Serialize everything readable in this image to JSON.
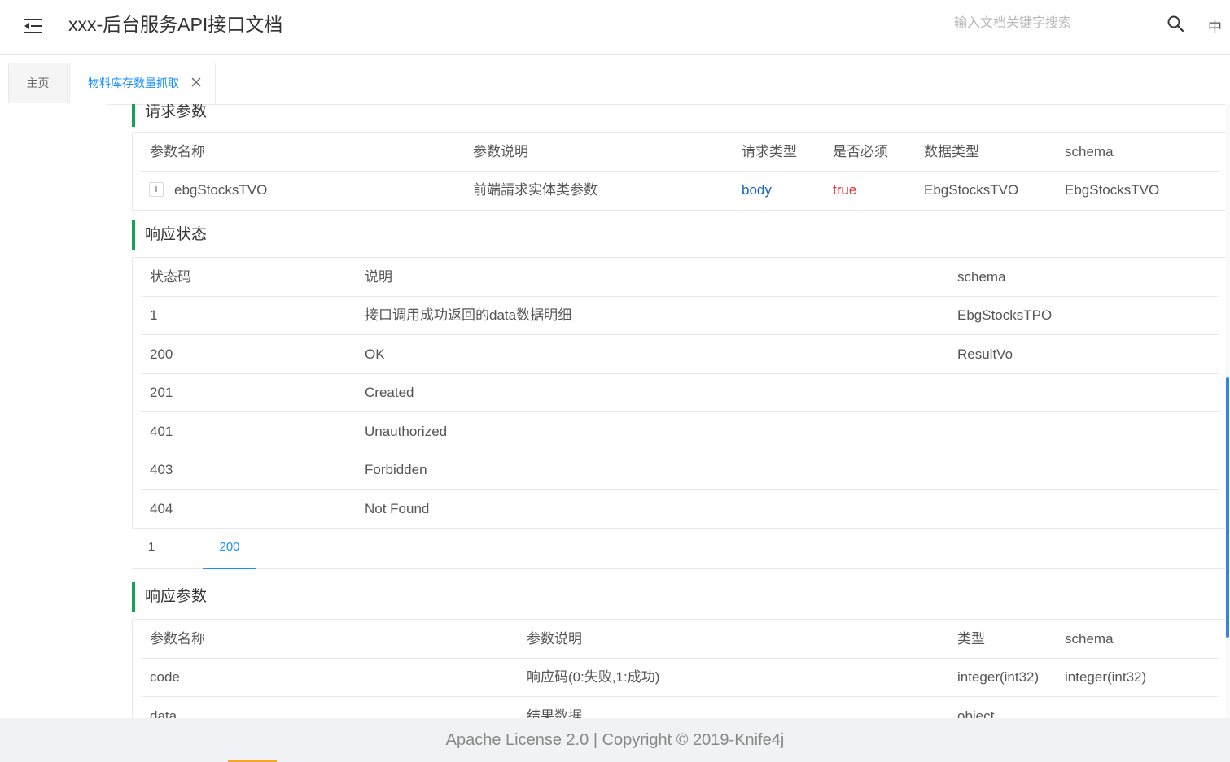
{
  "header": {
    "title": "xxx-后台服务API接口文档",
    "search_placeholder": "输入文档关键字搜索",
    "lang": "中"
  },
  "tabs": [
    {
      "label": "主页"
    },
    {
      "label": "物料库存数量抓取"
    }
  ],
  "request_params": {
    "title": "请求参数",
    "headers": [
      "参数名称",
      "参数说明",
      "请求类型",
      "是否必须",
      "数据类型",
      "schema"
    ],
    "rows": [
      {
        "expand": "+",
        "name": "ebgStocksTVO",
        "desc": "前端請求实体类参数",
        "in": "body",
        "required": "true",
        "type": "EbgStocksTVO",
        "schema": "EbgStocksTVO"
      }
    ]
  },
  "response_status": {
    "title": "响应状态",
    "headers": [
      "状态码",
      "说明",
      "schema"
    ],
    "rows": [
      {
        "code": "1",
        "desc": "接口调用成功返回的data数据明细",
        "schema": "EbgStocksTPO"
      },
      {
        "code": "200",
        "desc": "OK",
        "schema": "ResultVo"
      },
      {
        "code": "201",
        "desc": "Created",
        "schema": ""
      },
      {
        "code": "401",
        "desc": "Unauthorized",
        "schema": ""
      },
      {
        "code": "403",
        "desc": "Forbidden",
        "schema": ""
      },
      {
        "code": "404",
        "desc": "Not Found",
        "schema": ""
      }
    ]
  },
  "response_tabs": [
    "1",
    "200"
  ],
  "response_params": {
    "title": "响应参数",
    "headers": [
      "参数名称",
      "参数说明",
      "类型",
      "schema"
    ],
    "rows": [
      {
        "name": "code",
        "desc": "响应码(0:失败,1:成功)",
        "type": "integer(int32)",
        "schema": "integer(int32)"
      },
      {
        "name": "data",
        "desc": "结果数据",
        "type": "object",
        "schema": ""
      }
    ]
  },
  "footer": {
    "text": "Apache License 2.0 | Copyright © 2019-Knife4j"
  },
  "colors": {
    "accent": "#1890ff",
    "section_bar": "#1a9e5a",
    "request_type": "#1565c0",
    "required": "#e3242b"
  }
}
